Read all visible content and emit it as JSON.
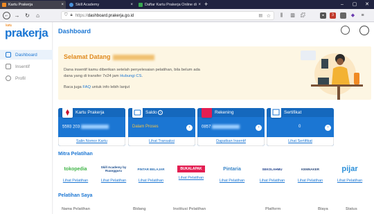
{
  "browser": {
    "tabs": [
      {
        "label": "Kartu Prakerja",
        "active": true
      },
      {
        "label": "Skill Academy",
        "active": false
      },
      {
        "label": "Daftar Kartu Prakerja Online di",
        "active": false
      }
    ],
    "url_prefix": "https://",
    "url_host": "dashboard.prakerja.go.id",
    "badge_count": "3"
  },
  "sidebar": {
    "logo_top": "kartu",
    "logo_main": "prakerja",
    "items": [
      {
        "label": "Dashboard",
        "active": true
      },
      {
        "label": "Insentif",
        "active": false
      },
      {
        "label": "Profil",
        "active": false
      }
    ]
  },
  "header": {
    "title": "Dashboard"
  },
  "welcome": {
    "greeting": "Selamat Datang",
    "line1": "Dana insentif kamu diberikan setelah penyelesaian pelatihan, bila belum ada",
    "line2_pre": "dana yang di transfer 7x24 jam ",
    "line2_link": "Hubungi CS",
    "line2_post": ".",
    "faq_pre": "Baca juga ",
    "faq_link": "FAQ",
    "faq_post": " untuk info lebih lanjut"
  },
  "cards": [
    {
      "title": "Kartu Prakerja",
      "value": "5593 203",
      "link": "Salin Nomor Kartu",
      "has_arrow": false,
      "value_color": "#ffffff"
    },
    {
      "title": "Saldo",
      "value": "Dalam Proses",
      "link": "Lihat Transaksi",
      "has_arrow": true,
      "value_color": "#f6c445"
    },
    {
      "title": "Rekening",
      "value": "0857",
      "link": "Dapatkan Insentif",
      "has_arrow": true,
      "value_color": "#ffffff"
    },
    {
      "title": "Sertifikat",
      "value": "0",
      "link": "Lihat Sertifikat",
      "has_arrow": true,
      "value_color": "#ffffff"
    }
  ],
  "mitra": {
    "title": "Mitra Pelatihan",
    "items": [
      {
        "name": "tokopedia",
        "color": "#42b549",
        "link": "Lihat Pelatihan"
      },
      {
        "name": "Skill Academy by Ruangguru",
        "color": "#1b4c8c",
        "link": "Lihat Pelatihan"
      },
      {
        "name": "PINTAR BELAJAR",
        "color": "#2a6fb5",
        "link": "Lihat Pelatihan"
      },
      {
        "name": "BUKALAPAK",
        "color": "#e31e52",
        "link": "Lihat Pelatihan"
      },
      {
        "name": "Pintaria",
        "color": "#3a86c8",
        "link": "Lihat Pelatihan"
      },
      {
        "name": "SEKOLAHMU",
        "color": "#1d3e8a",
        "link": "Lihat Pelatihan"
      },
      {
        "name": "KEMNAKER",
        "color": "#2b4a7c",
        "link": "Lihat Pelatihan"
      },
      {
        "name": "pijar",
        "color": "#2b8fd9",
        "link": "Lihat Pelatihan"
      }
    ]
  },
  "pelatihan": {
    "title": "Pelatihan Saya",
    "columns": [
      "Nama Pelatihan",
      "Bidang",
      "Institusi Pelatihan",
      "Platform",
      "Biaya",
      "Status"
    ]
  }
}
